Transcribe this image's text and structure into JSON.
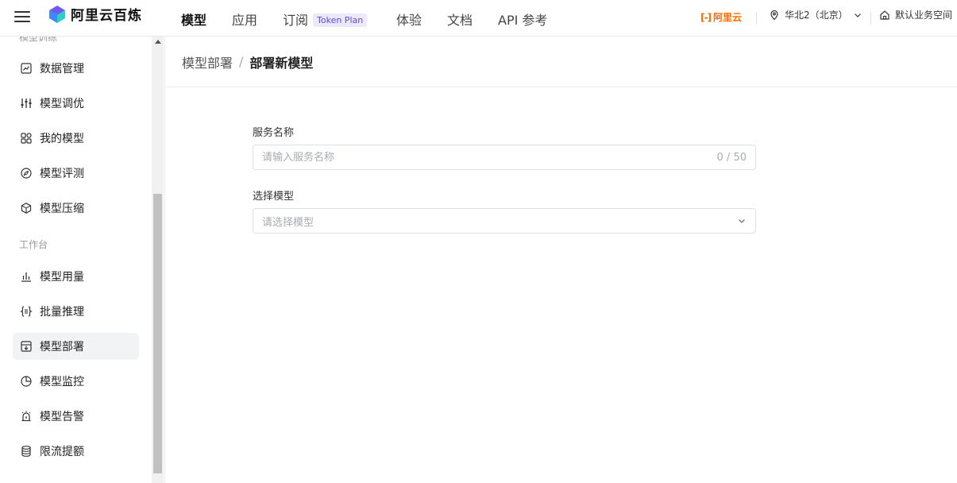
{
  "header": {
    "logo_text": "阿里云百炼",
    "nav": [
      {
        "label": "模型",
        "active": true
      },
      {
        "label": "应用",
        "active": false
      },
      {
        "label": "订阅",
        "badge": "Token Plan",
        "active": false
      },
      {
        "label": "体验",
        "active": false
      },
      {
        "label": "文档",
        "active": false
      },
      {
        "label": "API 参考",
        "active": false
      }
    ],
    "aliyun_mark": "[-]",
    "aliyun_label": "阿里云",
    "region": "华北2（北京）",
    "workspace": "默认业务空间"
  },
  "sidebar": {
    "group_cut": "模型训练",
    "items_top": [
      {
        "label": "数据管理",
        "icon": "chart-line-icon"
      },
      {
        "label": "模型调优",
        "icon": "sliders-icon"
      },
      {
        "label": "我的模型",
        "icon": "grid-icon"
      },
      {
        "label": "模型评测",
        "icon": "compass-icon"
      },
      {
        "label": "模型压缩",
        "icon": "cube-icon"
      }
    ],
    "group_workbench": "工作台",
    "items_bottom": [
      {
        "label": "模型用量",
        "icon": "bar-chart-icon"
      },
      {
        "label": "批量推理",
        "icon": "braces-icon"
      },
      {
        "label": "模型部署",
        "icon": "deploy-icon",
        "active": true
      },
      {
        "label": "模型监控",
        "icon": "pie-chart-icon"
      },
      {
        "label": "模型告警",
        "icon": "alarm-icon"
      },
      {
        "label": "限流提额",
        "icon": "database-icon"
      }
    ]
  },
  "breadcrumb": {
    "parent": "模型部署",
    "separator": "/",
    "current": "部署新模型"
  },
  "form": {
    "service_name_label": "服务名称",
    "service_name_placeholder": "请输入服务名称",
    "service_name_value": "",
    "service_name_counter": "0 / 50",
    "model_label": "选择模型",
    "model_placeholder": "请选择模型"
  },
  "colors": {
    "accent": "#5b4bd6",
    "aliyun_orange": "#ff6a00",
    "active_bg": "#f2f3f5"
  }
}
